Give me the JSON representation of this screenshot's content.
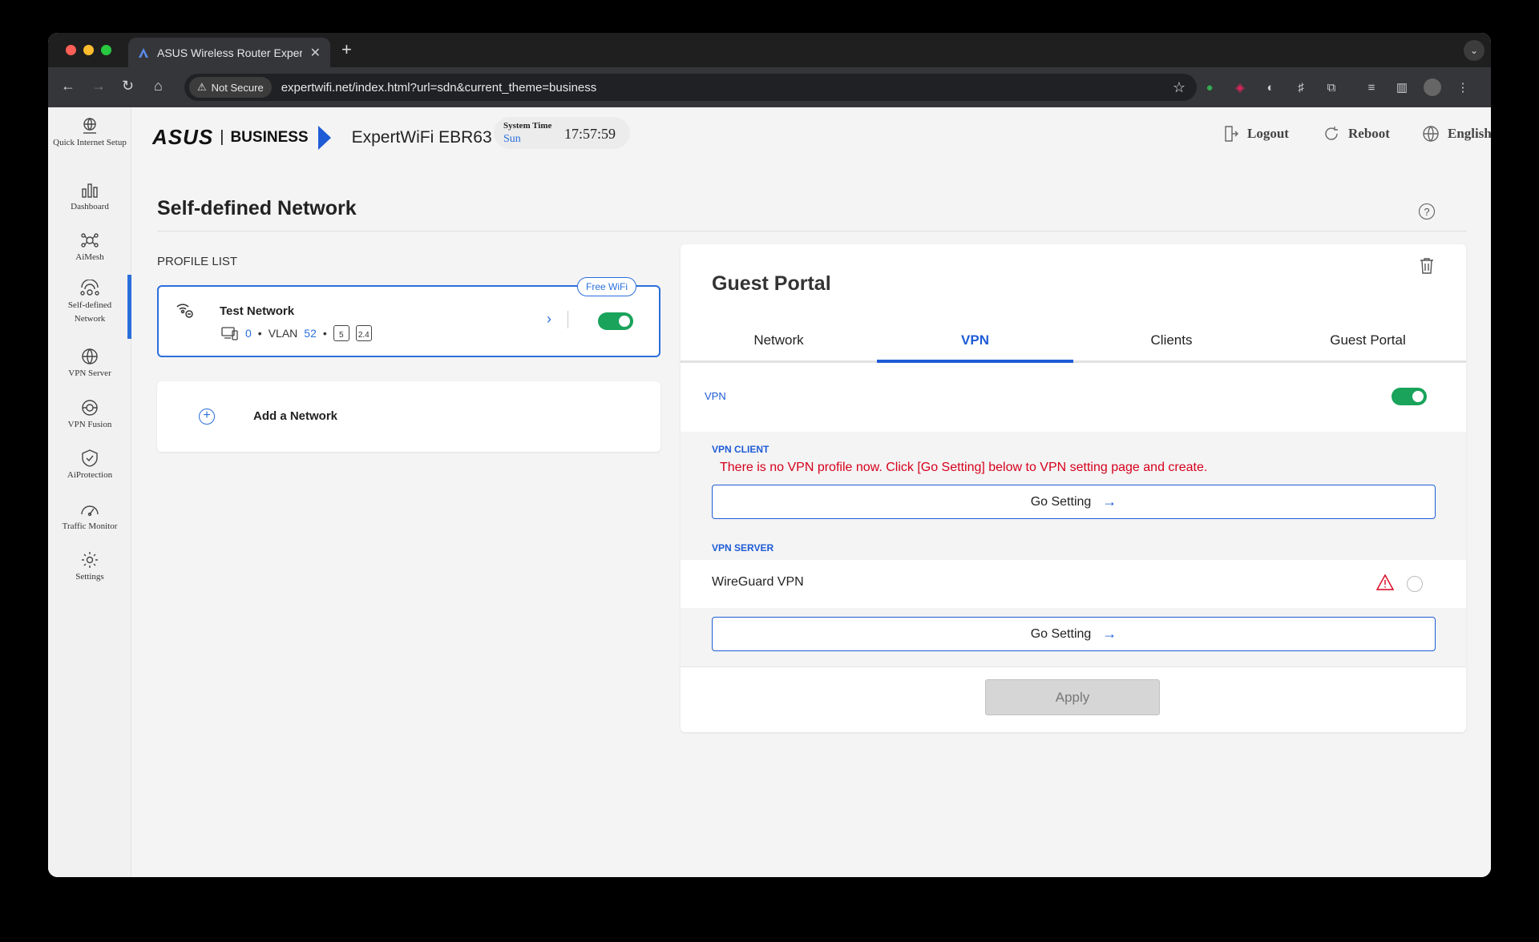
{
  "browser": {
    "tab_title": "ASUS Wireless Router Exper",
    "not_secure": "Not Secure",
    "url": "expertwifi.net/index.html?url=sdn&current_theme=business"
  },
  "sidebar": {
    "items": [
      {
        "label": "Quick Internet Setup",
        "icon": "globe-setup-icon"
      },
      {
        "label": "Dashboard",
        "icon": "bar-chart-icon"
      },
      {
        "label": "AiMesh",
        "icon": "mesh-icon"
      },
      {
        "label": "Self-defined Network",
        "icon": "network-icon"
      },
      {
        "label": "VPN Server",
        "icon": "vpn-server-icon"
      },
      {
        "label": "VPN Fusion",
        "icon": "vpn-fusion-icon"
      },
      {
        "label": "AiProtection",
        "icon": "shield-icon"
      },
      {
        "label": "Traffic Monitor",
        "icon": "gauge-icon"
      },
      {
        "label": "Settings",
        "icon": "gear-icon"
      }
    ],
    "active_index": 3
  },
  "header": {
    "brand": "ASUS",
    "business": "BUSINESS",
    "model": "ExpertWiFi EBR63",
    "system_time_label": "System Time",
    "day": "Sun",
    "time": "17:57:59",
    "logout": "Logout",
    "reboot": "Reboot",
    "language": "English"
  },
  "page": {
    "title": "Self-defined Network"
  },
  "profile_list": {
    "label": "PROFILE LIST",
    "profile": {
      "name": "Test Network",
      "badge": "Free WiFi",
      "clients": "0",
      "vlan_label": "VLAN",
      "vlan": "52",
      "band_5": "5",
      "band_24": "2.4",
      "enabled": true
    },
    "add_label": "Add a Network"
  },
  "panel": {
    "title": "Guest Portal",
    "tabs": [
      "Network",
      "VPN",
      "Clients",
      "Guest Portal"
    ],
    "active_tab": 1,
    "vpn_label": "VPN",
    "vpn_enabled": true,
    "vpn_client_header": "VPN CLIENT",
    "vpn_client_error": "There is no VPN profile now. Click [Go Setting] below to VPN setting page and create.",
    "go_setting": "Go Setting",
    "vpn_server_header": "VPN SERVER",
    "wireguard": "WireGuard VPN",
    "apply": "Apply"
  },
  "colors": {
    "accent": "#1e5bd6",
    "toggle_on": "#19a35b",
    "error": "#d6001c"
  }
}
